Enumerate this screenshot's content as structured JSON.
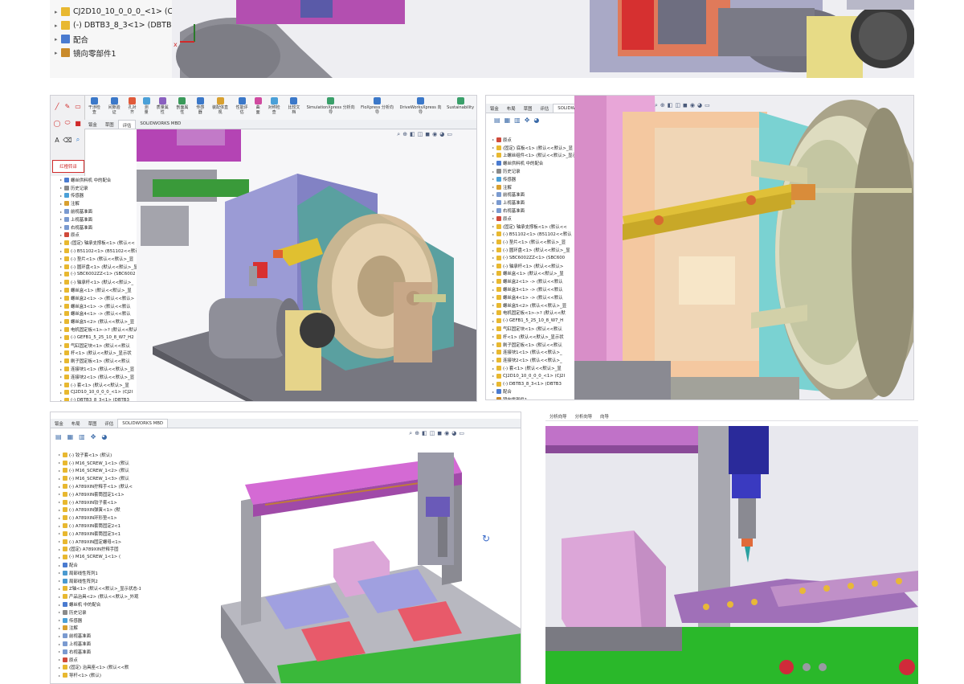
{
  "panel1": {
    "tree": [
      {
        "label": "CJ2D10_10_0_0_0_<1> (CJ2I",
        "icon": "part-icon",
        "color": "#e8b830"
      },
      {
        "label": "(-) DBTB3_8_3<1> (DBTB3-",
        "icon": "part-icon",
        "color": "#e8b830"
      },
      {
        "label": "配合",
        "icon": "mates-icon",
        "color": "#4a7bd0"
      },
      {
        "label": "镜向零部件1",
        "icon": "mirror-component-icon",
        "color": "#c98a2a"
      }
    ]
  },
  "panel2": {
    "ribbon": [
      {
        "label": "干涉检查",
        "icon": "interference-icon",
        "color": "#3b78c9"
      },
      {
        "label": "间隙验证",
        "icon": "clearance-icon",
        "color": "#3b78c9"
      },
      {
        "label": "孔对齐",
        "icon": "hole-align-icon",
        "color": "#e05a3a"
      },
      {
        "label": "测量",
        "icon": "measure-icon",
        "color": "#4aa0d8"
      },
      {
        "label": "质量属性",
        "icon": "mass-properties-icon",
        "color": "#8a60c0"
      },
      {
        "label": "剖面属性",
        "icon": "section-properties-icon",
        "color": "#3a9a5a"
      },
      {
        "label": "传感器",
        "icon": "sensor-icon",
        "color": "#3b78c9"
      },
      {
        "label": "装配体直观",
        "icon": "assembly-visualization-icon",
        "color": "#d8a030"
      },
      {
        "label": "性能评估",
        "icon": "performance-icon",
        "color": "#3b78c9"
      },
      {
        "label": "曲面",
        "icon": "curvature-icon",
        "color": "#d04aa0"
      },
      {
        "label": "对称检查",
        "icon": "symmetry-icon",
        "color": "#4aa0d8"
      },
      {
        "label": "比较文档",
        "icon": "compare-icon",
        "color": "#3b78c9"
      },
      {
        "label": "SimulationXpress 分析向导",
        "icon": "simulation-icon",
        "color": "#3aa06a"
      },
      {
        "label": "FloXpress 分析向导",
        "icon": "floxpress-icon",
        "color": "#3b78c9"
      },
      {
        "label": "DriveWorksXpress 向导",
        "icon": "driveworks-icon",
        "color": "#3b78c9"
      },
      {
        "label": "Sustainability",
        "icon": "sustainability-icon",
        "color": "#3aa06a"
      }
    ],
    "tabs": [
      {
        "label": "钣金",
        "active": false
      },
      {
        "label": "草图",
        "active": false
      },
      {
        "label": "评估",
        "active": true
      },
      {
        "label": "SOLIDWORKS MBD",
        "active": false
      }
    ],
    "red_button": "红橙转译",
    "tree": [
      {
        "label": "螺丝供料机 中的配合",
        "color": "#4a7bd0"
      },
      {
        "label": "历史记录",
        "color": "#8a8a8a"
      },
      {
        "label": "传感器",
        "color": "#4aa0d8"
      },
      {
        "label": "注解",
        "color": "#d8a030"
      },
      {
        "label": "前视基准面",
        "color": "#7a9ad0"
      },
      {
        "label": "上视基准面",
        "color": "#7a9ad0"
      },
      {
        "label": "右视基准面",
        "color": "#7a9ad0"
      },
      {
        "label": "原点",
        "color": "#d04a3a"
      },
      {
        "label": "(固定) 轴承支撑板<1> (默认<<",
        "color": "#e8b830"
      },
      {
        "label": "(-) B51102<1> (B51102<<默认",
        "color": "#e8b830"
      },
      {
        "label": "(-) 垫片<1> (默认<<默认>_显",
        "color": "#e8b830"
      },
      {
        "label": "(-) 圆环盘<1> (默认<<默认>_显",
        "color": "#e8b830"
      },
      {
        "label": "(-) SBC6002ZZ<1> (SBC6002",
        "color": "#e8b830"
      },
      {
        "label": "(-) 轴承杆<1> (默认<<默认>_",
        "color": "#e8b830"
      },
      {
        "label": "螺丝盒<1> (默认<<默认>_显",
        "color": "#e8b830"
      },
      {
        "label": "螺丝盒2<1> -> (默认<<默认>",
        "color": "#e8b830"
      },
      {
        "label": "螺丝盒3<1> -> (默认<<默认",
        "color": "#e8b830"
      },
      {
        "label": "螺丝盒4<1> -> (默认<<默认",
        "color": "#e8b830"
      },
      {
        "label": "螺丝盒5<2> (默认<<默认>_显",
        "color": "#e8b830"
      },
      {
        "label": "电机固定板<1>->? (默认<<默认",
        "color": "#e8b830"
      },
      {
        "label": "(-) GEFB1_5_25_10_8_W7_H2",
        "color": "#e8b830"
      },
      {
        "label": "气缸固定块<1> (默认<<默认",
        "color": "#e8b830"
      },
      {
        "label": "杆<1> (默认<<默认>_显示状",
        "color": "#e8b830"
      },
      {
        "label": "刷子固定板<1> (默认<<默认",
        "color": "#e8b830"
      },
      {
        "label": "连接块1<1> (默认<<默认>_显",
        "color": "#e8b830"
      },
      {
        "label": "连接块2<1> (默认<<默认>_显",
        "color": "#e8b830"
      },
      {
        "label": "(-) 套<1> (默认<<默认>_显",
        "color": "#e8b830"
      },
      {
        "label": "CJ2D10_10_0_0_0_<1> (CJ2I",
        "color": "#e8b830"
      },
      {
        "label": "(-) DBTB3_8_3<1> (DBTB3",
        "color": "#e8b830"
      }
    ]
  },
  "panel3": {
    "tabs": [
      {
        "label": "钣金",
        "active": false
      },
      {
        "label": "布局",
        "active": false
      },
      {
        "label": "草图",
        "active": false
      },
      {
        "label": "评估",
        "active": false
      },
      {
        "label": "SOLIDWORKS MBD",
        "active": true
      }
    ],
    "tree": [
      {
        "label": "原点",
        "color": "#d04a3a"
      },
      {
        "label": "(固定) 底板<1> (默认<<默认>_显",
        "color": "#e8b830"
      },
      {
        "label": "上螺丝组件<1> (默认<<默认>_显示",
        "color": "#e8b830"
      },
      {
        "label": "螺丝供料机 中的配合",
        "color": "#4a7bd0"
      },
      {
        "label": "历史记录",
        "color": "#8a8a8a"
      },
      {
        "label": "传感器",
        "color": "#4aa0d8"
      },
      {
        "label": "注解",
        "color": "#d8a030"
      },
      {
        "label": "前视基准面",
        "color": "#7a9ad0"
      },
      {
        "label": "上视基准面",
        "color": "#7a9ad0"
      },
      {
        "label": "右视基准面",
        "color": "#7a9ad0"
      },
      {
        "label": "原点",
        "color": "#d04a3a"
      },
      {
        "label": "(固定) 轴承支撑板<1> (默认<<",
        "color": "#e8b830"
      },
      {
        "label": "(-) B51102<1> (B51102<<默认",
        "color": "#e8b830"
      },
      {
        "label": "(-) 垫片<1> (默认<<默认>_显",
        "color": "#e8b830"
      },
      {
        "label": "(-) 圆环盘<1> (默认<<默认>_显",
        "color": "#e8b830"
      },
      {
        "label": "(-) SBC6002ZZ<1> (SBC600",
        "color": "#e8b830"
      },
      {
        "label": "(-) 轴承杆<1> (默认<<默认>",
        "color": "#e8b830"
      },
      {
        "label": "螺丝盒<1> (默认<<默认>_显",
        "color": "#e8b830"
      },
      {
        "label": "螺丝盒2<1> -> (默认<<默认",
        "color": "#e8b830"
      },
      {
        "label": "螺丝盒3<1> -> (默认<<默认",
        "color": "#e8b830"
      },
      {
        "label": "螺丝盒4<1> -> (默认<<默认",
        "color": "#e8b830"
      },
      {
        "label": "螺丝盒5<2> (默认<<默认>_显",
        "color": "#e8b830"
      },
      {
        "label": "电机固定板<1>->? (默认<<默",
        "color": "#e8b830"
      },
      {
        "label": "(-) GEFB1_5_25_10_8_W7_H",
        "color": "#e8b830"
      },
      {
        "label": "气缸固定块<1> (默认<<默认",
        "color": "#e8b830"
      },
      {
        "label": "杆<1> (默认<<默认>_显示状",
        "color": "#e8b830"
      },
      {
        "label": "刷子固定板<1> (默认<<默认",
        "color": "#e8b830"
      },
      {
        "label": "连接块1<1> (默认<<默认>_",
        "color": "#e8b830"
      },
      {
        "label": "连接块2<1> (默认<<默认>_",
        "color": "#e8b830"
      },
      {
        "label": "(-) 套<1> (默认<<默认>_显",
        "color": "#e8b830"
      },
      {
        "label": "CJ2D10_10_0_0_0_<1> (CJ2I",
        "color": "#e8b830"
      },
      {
        "label": "(-) DBTB3_8_3<1> (DBTB3",
        "color": "#e8b830"
      },
      {
        "label": "配合",
        "color": "#4a7bd0"
      },
      {
        "label": "镜向零部件1",
        "color": "#c98a2a"
      }
    ]
  },
  "panel4": {
    "tabs": [
      {
        "label": "钣金",
        "active": false
      },
      {
        "label": "布局",
        "active": false
      },
      {
        "label": "草图",
        "active": false
      },
      {
        "label": "评估",
        "active": false
      },
      {
        "label": "SOLIDWORKS MBD",
        "active": true
      }
    ],
    "tree": [
      {
        "label": "(-) 铰子套<1> (默认)",
        "color": "#e8b830"
      },
      {
        "label": "(-) M16_SCREW_1<1> (默认",
        "color": "#e8b830"
      },
      {
        "label": "(-) M16_SCREW_1<2> (默认",
        "color": "#e8b830"
      },
      {
        "label": "(-) M16_SCREW_1<3> (默认",
        "color": "#e8b830"
      },
      {
        "label": "(-) A789XIN拧释手<1> (默认<",
        "color": "#e8b830"
      },
      {
        "label": "(-) A789XIN套筒固定1<1>",
        "color": "#e8b830"
      },
      {
        "label": "(-) A789XIN铰子套<1>",
        "color": "#e8b830"
      },
      {
        "label": "(-) A789XIN弹簧<1> (默",
        "color": "#e8b830"
      },
      {
        "label": "(-) A789XIN环形垫<1>",
        "color": "#e8b830"
      },
      {
        "label": "(-) A789XIN套筒固定2<1",
        "color": "#e8b830"
      },
      {
        "label": "(-) A789XIN套筒固定3<1",
        "color": "#e8b830"
      },
      {
        "label": "(-) A789XIN固定螺母<1>",
        "color": "#e8b830"
      },
      {
        "label": "(固定) A789XIN拧释手固",
        "color": "#e8b830"
      },
      {
        "label": "(-) M16_SCREW_1<1> (",
        "color": "#e8b830"
      },
      {
        "label": "配合",
        "color": "#4a7bd0"
      },
      {
        "label": "局部线性阵列1",
        "color": "#4a9ad0"
      },
      {
        "label": "局部线性阵列2",
        "color": "#4a9ad0"
      },
      {
        "label": "Z轴<1> (默认<<默认>_显示状态-1>",
        "color": "#e8b830"
      },
      {
        "label": "产品治具<2> (默认<<默认>_外观",
        "color": "#e8b830"
      },
      {
        "label": "螺丝机 中的配合",
        "color": "#4a7bd0"
      },
      {
        "label": "历史记录",
        "color": "#8a8a8a"
      },
      {
        "label": "传感器",
        "color": "#4aa0d8"
      },
      {
        "label": "注解",
        "color": "#d8a030"
      },
      {
        "label": "前视基准面",
        "color": "#7a9ad0"
      },
      {
        "label": "上视基准面",
        "color": "#7a9ad0"
      },
      {
        "label": "右视基准面",
        "color": "#7a9ad0"
      },
      {
        "label": "原点",
        "color": "#d04a3a"
      },
      {
        "label": "(固定) 治具座<1> (默认<<默",
        "color": "#e8b830"
      },
      {
        "label": "导杆<1> (默认)",
        "color": "#e8b830"
      }
    ]
  },
  "panel5": {
    "tabs": [
      {
        "label": "分析向导",
        "active": false
      },
      {
        "label": "分析向导",
        "active": false
      },
      {
        "label": "向导",
        "active": false
      }
    ]
  }
}
